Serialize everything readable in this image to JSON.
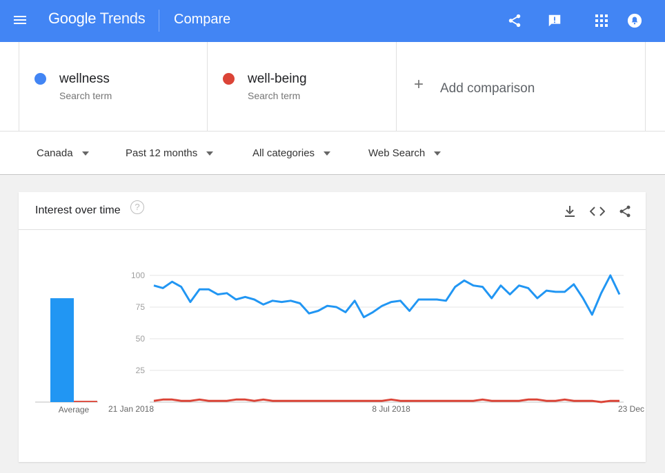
{
  "header": {
    "brand_google": "Google",
    "brand_trends": "Trends",
    "page_title": "Compare",
    "color": "#4285f4"
  },
  "terms": [
    {
      "name": "wellness",
      "type_label": "Search term",
      "color": "#4285f4"
    },
    {
      "name": "well-being",
      "type_label": "Search term",
      "color": "#db4437"
    }
  ],
  "add_comparison": {
    "icon": "+",
    "label": "Add comparison"
  },
  "filters": [
    {
      "label": "Canada"
    },
    {
      "label": "Past 12 months"
    },
    {
      "label": "All categories"
    },
    {
      "label": "Web Search"
    }
  ],
  "card": {
    "title": "Interest over time",
    "help_icon": "?"
  },
  "chart_data": {
    "type": "line",
    "title": "Interest over time",
    "ylim": [
      0,
      100
    ],
    "yticks": [
      "100",
      "75",
      "50",
      "25"
    ],
    "ytick_values": [
      100,
      75,
      50,
      25
    ],
    "xtick_labels": [
      "21 Jan 2018",
      "8 Jul 2018",
      "23 Dec 2018"
    ],
    "series": [
      {
        "name": "wellness",
        "color": "#2196f3",
        "average": 82,
        "values": [
          92,
          90,
          95,
          91,
          79,
          89,
          89,
          85,
          86,
          81,
          83,
          81,
          77,
          80,
          79,
          80,
          78,
          70,
          72,
          76,
          75,
          71,
          80,
          67,
          71,
          76,
          79,
          80,
          72,
          81,
          81,
          81,
          80,
          91,
          96,
          92,
          91,
          82,
          92,
          85,
          92,
          90,
          82,
          88,
          87,
          87,
          93,
          82,
          69,
          86,
          100,
          85
        ]
      },
      {
        "name": "well-being",
        "color": "#db4437",
        "average": 1,
        "values": [
          1,
          2,
          2,
          1,
          1,
          2,
          1,
          1,
          1,
          2,
          2,
          1,
          2,
          1,
          1,
          1,
          1,
          1,
          1,
          1,
          1,
          1,
          1,
          1,
          1,
          1,
          2,
          1,
          1,
          1,
          1,
          1,
          1,
          1,
          1,
          1,
          2,
          1,
          1,
          1,
          1,
          2,
          2,
          1,
          1,
          2,
          1,
          1,
          1,
          0,
          1,
          1
        ]
      }
    ],
    "average_label": "Average"
  }
}
